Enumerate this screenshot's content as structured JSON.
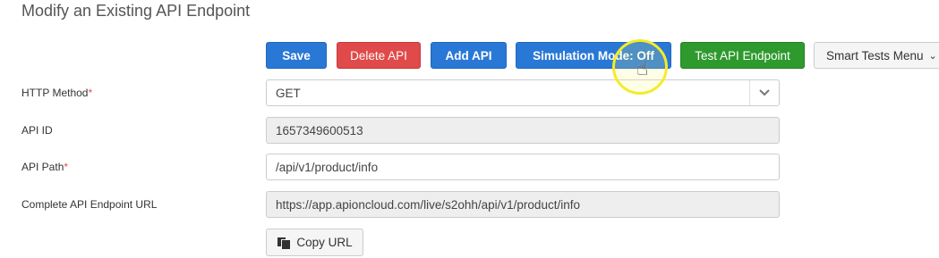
{
  "page": {
    "title": "Modify an Existing API Endpoint"
  },
  "toolbar": {
    "save_label": "Save",
    "delete_label": "Delete API",
    "add_label": "Add API",
    "simulation_label": "Simulation Mode: Off",
    "test_label": "Test API Endpoint",
    "smart_tests_label": "Smart Tests Menu"
  },
  "form": {
    "http_method": {
      "label": "HTTP Method",
      "required_mark": "*",
      "value": "GET"
    },
    "api_id": {
      "label": "API ID",
      "value": "1657349600513"
    },
    "api_path": {
      "label": "API Path",
      "required_mark": "*",
      "value": "/api/v1/product/info"
    },
    "endpoint_url": {
      "label": "Complete API Endpoint URL",
      "value": "https://app.apioncloud.com/live/s2ohh/api/v1/product/info"
    },
    "copy_label": "Copy URL"
  },
  "colors": {
    "primary": "#2a78d5",
    "danger": "#e04a4a",
    "success": "#2e9a2e",
    "cursor_highlight": "#f3ec2a"
  }
}
